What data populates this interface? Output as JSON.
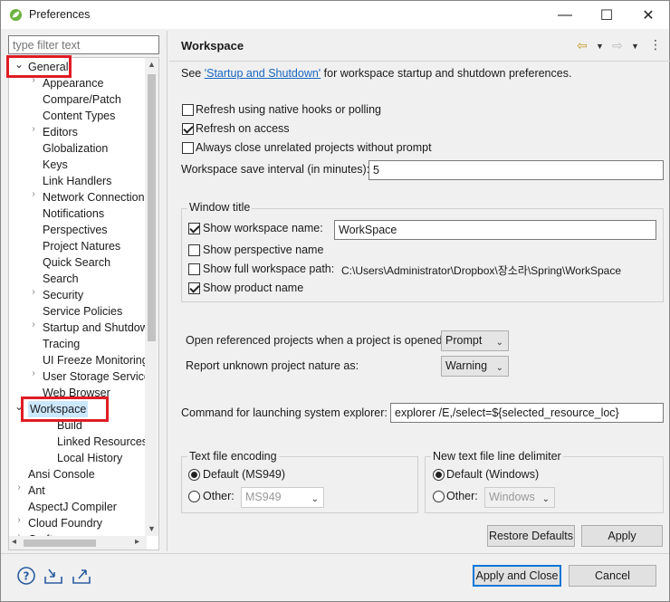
{
  "window": {
    "title": "Preferences",
    "minimize": "—",
    "maximize": "☐",
    "close": "✕"
  },
  "filter": {
    "placeholder": "type filter text"
  },
  "tree": {
    "items": [
      {
        "label": "General",
        "twisty": "⌄"
      },
      {
        "label": "Appearance",
        "twisty": "›"
      },
      {
        "label": "Compare/Patch",
        "twisty": ""
      },
      {
        "label": "Content Types",
        "twisty": ""
      },
      {
        "label": "Editors",
        "twisty": "›"
      },
      {
        "label": "Globalization",
        "twisty": ""
      },
      {
        "label": "Keys",
        "twisty": ""
      },
      {
        "label": "Link Handlers",
        "twisty": ""
      },
      {
        "label": "Network Connections",
        "twisty": "›"
      },
      {
        "label": "Notifications",
        "twisty": ""
      },
      {
        "label": "Perspectives",
        "twisty": ""
      },
      {
        "label": "Project Natures",
        "twisty": ""
      },
      {
        "label": "Quick Search",
        "twisty": ""
      },
      {
        "label": "Search",
        "twisty": ""
      },
      {
        "label": "Security",
        "twisty": "›"
      },
      {
        "label": "Service Policies",
        "twisty": ""
      },
      {
        "label": "Startup and Shutdown",
        "twisty": "›"
      },
      {
        "label": "Tracing",
        "twisty": ""
      },
      {
        "label": "UI Freeze Monitoring",
        "twisty": ""
      },
      {
        "label": "User Storage Service",
        "twisty": "›"
      },
      {
        "label": "Web Browser",
        "twisty": ""
      },
      {
        "label": "Workspace",
        "twisty": "⌄"
      },
      {
        "label": "Build",
        "twisty": ""
      },
      {
        "label": "Linked Resources",
        "twisty": ""
      },
      {
        "label": "Local History",
        "twisty": ""
      },
      {
        "label": "Ansi Console",
        "twisty": ""
      },
      {
        "label": "Ant",
        "twisty": "›"
      },
      {
        "label": "AspectJ Compiler",
        "twisty": ""
      },
      {
        "label": "Cloud Foundry",
        "twisty": "›"
      },
      {
        "label": "Cruft",
        "twisty": "›"
      }
    ]
  },
  "page": {
    "title": "Workspace",
    "see_prefix": "See ",
    "see_link": "'Startup and Shutdown'",
    "see_suffix": " for workspace startup and shutdown preferences.",
    "refresh_native": "Refresh using native hooks or polling",
    "refresh_access": "Refresh on access",
    "always_close": "Always close unrelated projects without prompt",
    "save_interval_label": "Workspace save interval (in minutes):",
    "save_interval_value": "5",
    "window_title_group": "Window title",
    "show_ws_name": "Show workspace name:",
    "ws_name_value": "WorkSpace",
    "show_perspective": "Show perspective name",
    "show_full_path": "Show full workspace path:",
    "full_path_value": "C:\\Users\\Administrator\\Dropbox\\장소라\\Spring\\WorkSpace",
    "show_product": "Show product name",
    "open_ref_label": "Open referenced projects when a project is opened:",
    "open_ref_value": "Prompt",
    "report_nature_label": "Report unknown project nature as:",
    "report_nature_value": "Warning",
    "cmd_label": "Command for launching system explorer:",
    "cmd_value": "explorer /E,/select=${selected_resource_loc}",
    "encoding_group": "Text file encoding",
    "encoding_default": "Default (MS949)",
    "encoding_other": "Other:",
    "encoding_other_value": "MS949",
    "delim_group": "New text file line delimiter",
    "delim_default": "Default (Windows)",
    "delim_other": "Other:",
    "delim_other_value": "Windows",
    "restore_defaults": "Restore Defaults",
    "apply": "Apply"
  },
  "footer": {
    "apply_close": "Apply and Close",
    "cancel": "Cancel"
  },
  "colors": {
    "highlight": "#e01c24",
    "link": "#1766c2",
    "default_button": "#0078d7"
  }
}
